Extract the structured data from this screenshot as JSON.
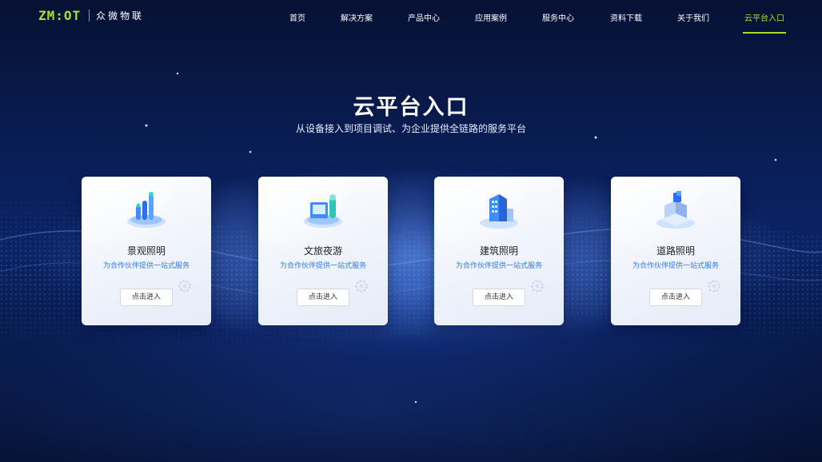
{
  "header": {
    "logo_text": "ZM:OT",
    "brand_cn": "众微物联",
    "nav": [
      {
        "label": "首页"
      },
      {
        "label": "解决方案"
      },
      {
        "label": "产品中心"
      },
      {
        "label": "应用案例"
      },
      {
        "label": "服务中心"
      },
      {
        "label": "资料下载"
      },
      {
        "label": "关于我们"
      },
      {
        "label": "云平台入口",
        "active": true
      }
    ],
    "accent_color": "#a6e02c"
  },
  "hero": {
    "title": "云平台入口",
    "subtitle": "从设备接入到项目调试、为企业提供全链路的服务平台"
  },
  "cards": [
    {
      "title": "景观照明",
      "desc": "为合作伙伴提供一站式服务",
      "button": "点击进入",
      "icon": "landscape-lighting-icon"
    },
    {
      "title": "文旅夜游",
      "desc": "为合作伙伴提供一站式服务",
      "button": "点击进入",
      "icon": "cultural-tourism-icon"
    },
    {
      "title": "建筑照明",
      "desc": "为合作伙伴提供一站式服务",
      "button": "点击进入",
      "icon": "building-lighting-icon"
    },
    {
      "title": "道路照明",
      "desc": "为合作伙伴提供一站式服务",
      "button": "点击进入",
      "icon": "road-lighting-icon"
    }
  ],
  "colors": {
    "card_desc": "#2f7cf6",
    "background": "#0b2466"
  }
}
